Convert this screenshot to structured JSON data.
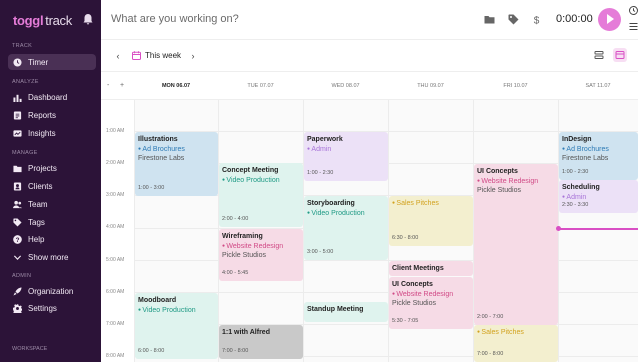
{
  "sidebar": {
    "logo_main": "toggl",
    "logo_product": "track",
    "sections": {
      "track": "TRACK",
      "analyze": "ANALYZE",
      "manage": "MANAGE",
      "admin": "ADMIN",
      "workspace": "WORKSPACE"
    },
    "items": [
      {
        "label": "Timer",
        "icon": "clock-icon",
        "active": true
      },
      {
        "label": "Dashboard",
        "icon": "bar-chart-icon"
      },
      {
        "label": "Reports",
        "icon": "report-icon"
      },
      {
        "label": "Insights",
        "icon": "insights-icon"
      },
      {
        "label": "Projects",
        "icon": "folder-icon"
      },
      {
        "label": "Clients",
        "icon": "client-icon"
      },
      {
        "label": "Team",
        "icon": "team-icon"
      },
      {
        "label": "Tags",
        "icon": "tag-icon"
      },
      {
        "label": "Help",
        "icon": "help-icon"
      },
      {
        "label": "Show more",
        "icon": "chevron-down-icon"
      },
      {
        "label": "Organization",
        "icon": "rocket-icon"
      },
      {
        "label": "Settings",
        "icon": "gear-icon"
      }
    ]
  },
  "header": {
    "prompt": "What are you working on?",
    "timer": "0:00:00",
    "accent": "#e57cd8"
  },
  "weekbar": {
    "label": "This week",
    "zoom_minus": "-",
    "zoom_plus": "+"
  },
  "days": [
    "MON 06.07",
    "TUE 07.07",
    "WED 08.07",
    "THU 09.07",
    "FRI 10.07",
    "SAT 11.07"
  ],
  "times": [
    "1:00 AM",
    "2:00 AM",
    "3:00 AM",
    "4:00 AM",
    "5:00 AM",
    "6:00 AM",
    "7:00 AM",
    "8:00 AM"
  ],
  "events": [
    {
      "title": "Illustrations",
      "project": "Ad Brochures",
      "client": "Firestone Labs",
      "time": "1:00 - 3:00",
      "color": "#cfe3f0",
      "dot": "#2e7bb5"
    },
    {
      "title": "Concept Meeting",
      "project": "Video Production",
      "client": "",
      "time": "2:00 - 4:00",
      "color": "#dff3ee",
      "dot": "#1f9a85"
    },
    {
      "title": "Wireframing",
      "project": "Website Redesign",
      "client": "Pickle Studios",
      "time": "4:00 - 5:45",
      "color": "#f6dbe6",
      "dot": "#d14a86"
    },
    {
      "title": "Paperwork",
      "project": "Admin",
      "client": "",
      "time": "1:00 - 2:30",
      "color": "#ece1f7",
      "dot": "#a874d8"
    },
    {
      "title": "Storyboarding",
      "project": "Video Production",
      "client": "",
      "time": "3:00 - 5:00",
      "color": "#dff3ee",
      "dot": "#1f9a85"
    },
    {
      "title": "Standup Meeting",
      "project": "",
      "client": "",
      "time": "",
      "color": "#dff3ee",
      "dot": "#1f9a85"
    },
    {
      "title": "",
      "project": "Sales Pitches",
      "client": "",
      "time": "6:30 - 8:00",
      "color": "#f3efcf",
      "dot": "#d2a21e"
    },
    {
      "title": "Client Meetings",
      "project": "",
      "client": "",
      "time": "",
      "color": "#f6dbe6",
      "dot": "#d14a86"
    },
    {
      "title": "UI Concepts",
      "project": "Website Redesign",
      "client": "Pickle Studios",
      "time": "5:30 - 7:05",
      "color": "#f6dbe6",
      "dot": "#d14a86"
    },
    {
      "title": "UI Concepts",
      "project": "Website Redesign",
      "client": "Pickle Studios",
      "time": "2:00 - 7:00",
      "color": "#f6dbe6",
      "dot": "#d14a86"
    },
    {
      "title": "",
      "project": "Sales Pitches",
      "client": "",
      "time": "7:00 - 8:00",
      "color": "#f3efcf",
      "dot": "#d2a21e"
    },
    {
      "title": "Moodboard",
      "project": "Video Production",
      "client": "",
      "time": "6:00 - 8:00",
      "color": "#dff3ee",
      "dot": "#1f9a85"
    },
    {
      "title": "1:1 with Alfred",
      "project": "",
      "client": "",
      "time": "7:00 - 8:00",
      "color": "#c9c9c9",
      "dot": "#555"
    },
    {
      "title": "InDesign",
      "project": "Ad Brochures",
      "client": "Firestone Labs",
      "time": "1:00 - 2:30",
      "color": "#cfe3f0",
      "dot": "#2e7bb5"
    },
    {
      "title": "Scheduling",
      "project": "Admin",
      "client": "",
      "time": "2:30 - 3:30",
      "color": "#ece1f7",
      "dot": "#a874d8"
    }
  ]
}
